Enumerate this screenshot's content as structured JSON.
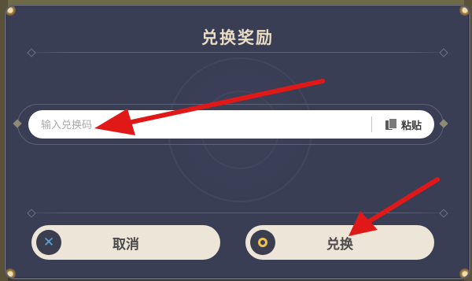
{
  "dialog": {
    "title": "兑换奖励"
  },
  "code_input": {
    "placeholder": "输入兑换码",
    "value": ""
  },
  "paste_button": {
    "label": "粘贴",
    "icon": "paste-icon"
  },
  "buttons": {
    "cancel": {
      "label": "取消",
      "icon": "x-icon"
    },
    "confirm": {
      "label": "兑换",
      "icon": "circle-icon"
    }
  },
  "colors": {
    "dialog_bg": "#3a3e55",
    "title": "#e8dcc2",
    "button_bg": "#ece5d8",
    "cancel_icon": "#5aa6d8",
    "confirm_icon": "#f0c24d",
    "annotation_arrow": "#e01818"
  }
}
